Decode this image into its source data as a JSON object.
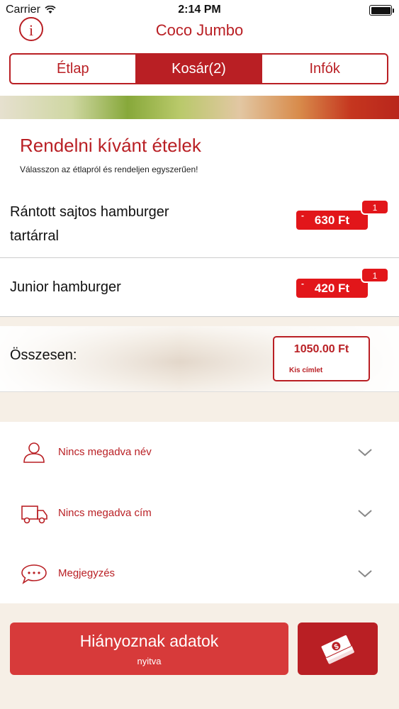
{
  "status_bar": {
    "carrier": "Carrier",
    "time": "2:14 PM"
  },
  "nav": {
    "info_label": "i",
    "title": "Coco Jumbo"
  },
  "tabs": [
    {
      "label": "Étlap",
      "active": false
    },
    {
      "label": "Kosár(2)",
      "active": true
    },
    {
      "label": "Infók",
      "active": false
    }
  ],
  "header": {
    "title": "Rendelni kívánt ételek",
    "subtitle": "Válasszon az étlapról és rendeljen egyszerűen!"
  },
  "cart_items": [
    {
      "name": "Rántott sajtos hamburger tartárral",
      "price": "630 Ft",
      "quantity": "1"
    },
    {
      "name": "Junior hamburger",
      "price": "420 Ft",
      "quantity": "1"
    }
  ],
  "total": {
    "label": "Összesen:",
    "amount": "1050.00 Ft",
    "note": "Kis címlet"
  },
  "form": {
    "name": "Nincs megadva név",
    "address": "Nincs megadva cím",
    "comment": "Megjegyzés"
  },
  "actions": {
    "missing_main": "Hiányoznak adatok",
    "missing_sub": "nyitva"
  },
  "colors": {
    "accent": "#b91f24",
    "badge": "#e2161a",
    "button": "#d73a3a",
    "background": "#f6efe6"
  }
}
